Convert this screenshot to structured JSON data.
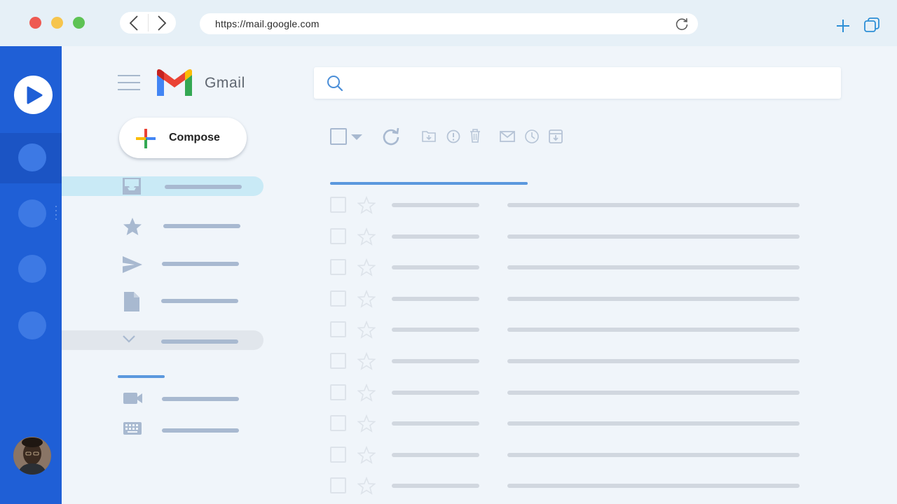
{
  "browser": {
    "url": "https://mail.google.com",
    "traffic_lights": [
      "#ee5a52",
      "#f6c54d",
      "#5ec354"
    ]
  },
  "app": {
    "name": "Gmail",
    "compose_label": "Compose"
  },
  "colors": {
    "rail": "#1f5fd6",
    "accent": "#5b98de",
    "placeholder_line": "#a8b9d0",
    "row_line": "#d1d7df"
  },
  "sidebar": {
    "items": [
      {
        "icon": "inbox-icon",
        "state": "active"
      },
      {
        "icon": "star-icon",
        "state": "normal"
      },
      {
        "icon": "send-icon",
        "state": "normal"
      },
      {
        "icon": "draft-icon",
        "state": "normal"
      },
      {
        "icon": "chevron-down-icon",
        "state": "more"
      }
    ],
    "meet_items": [
      {
        "icon": "video-icon"
      },
      {
        "icon": "keyboard-icon"
      }
    ]
  },
  "toolbar": {
    "icons": [
      "select-all-checkbox",
      "select-dropdown-icon",
      "refresh-icon",
      "move-to-icon",
      "report-spam-icon",
      "delete-icon",
      "mark-as-read-icon",
      "snooze-icon",
      "archive-icon"
    ]
  },
  "email_rows": 10
}
